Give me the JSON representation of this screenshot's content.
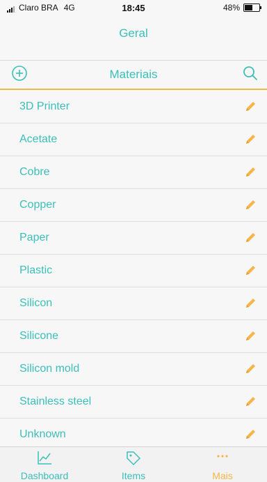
{
  "status": {
    "carrier": "Claro BRA",
    "network": "4G",
    "time": "18:45",
    "battery_percent": "48%",
    "battery_level": 0.48
  },
  "nav": {
    "title": "Geral"
  },
  "header": {
    "title": "Materiais",
    "add_icon": "plus-circle-icon",
    "search_icon": "magnifier-icon"
  },
  "materials": [
    "3D Printer",
    "Acetate",
    "Cobre",
    "Copper",
    "Paper",
    "Plastic",
    "Silicon",
    "Silicone",
    "Silicon mold",
    "Stainless steel",
    "Unknown"
  ],
  "tabs": [
    {
      "label": "Dashboard",
      "icon": "line-chart-icon"
    },
    {
      "label": "Items",
      "icon": "tag-icon"
    },
    {
      "label": "Mais",
      "icon": "more-dots-icon"
    }
  ],
  "colors": {
    "accent": "#3bbfb8",
    "highlight": "#f4b64a",
    "background": "#f7f7f7"
  }
}
